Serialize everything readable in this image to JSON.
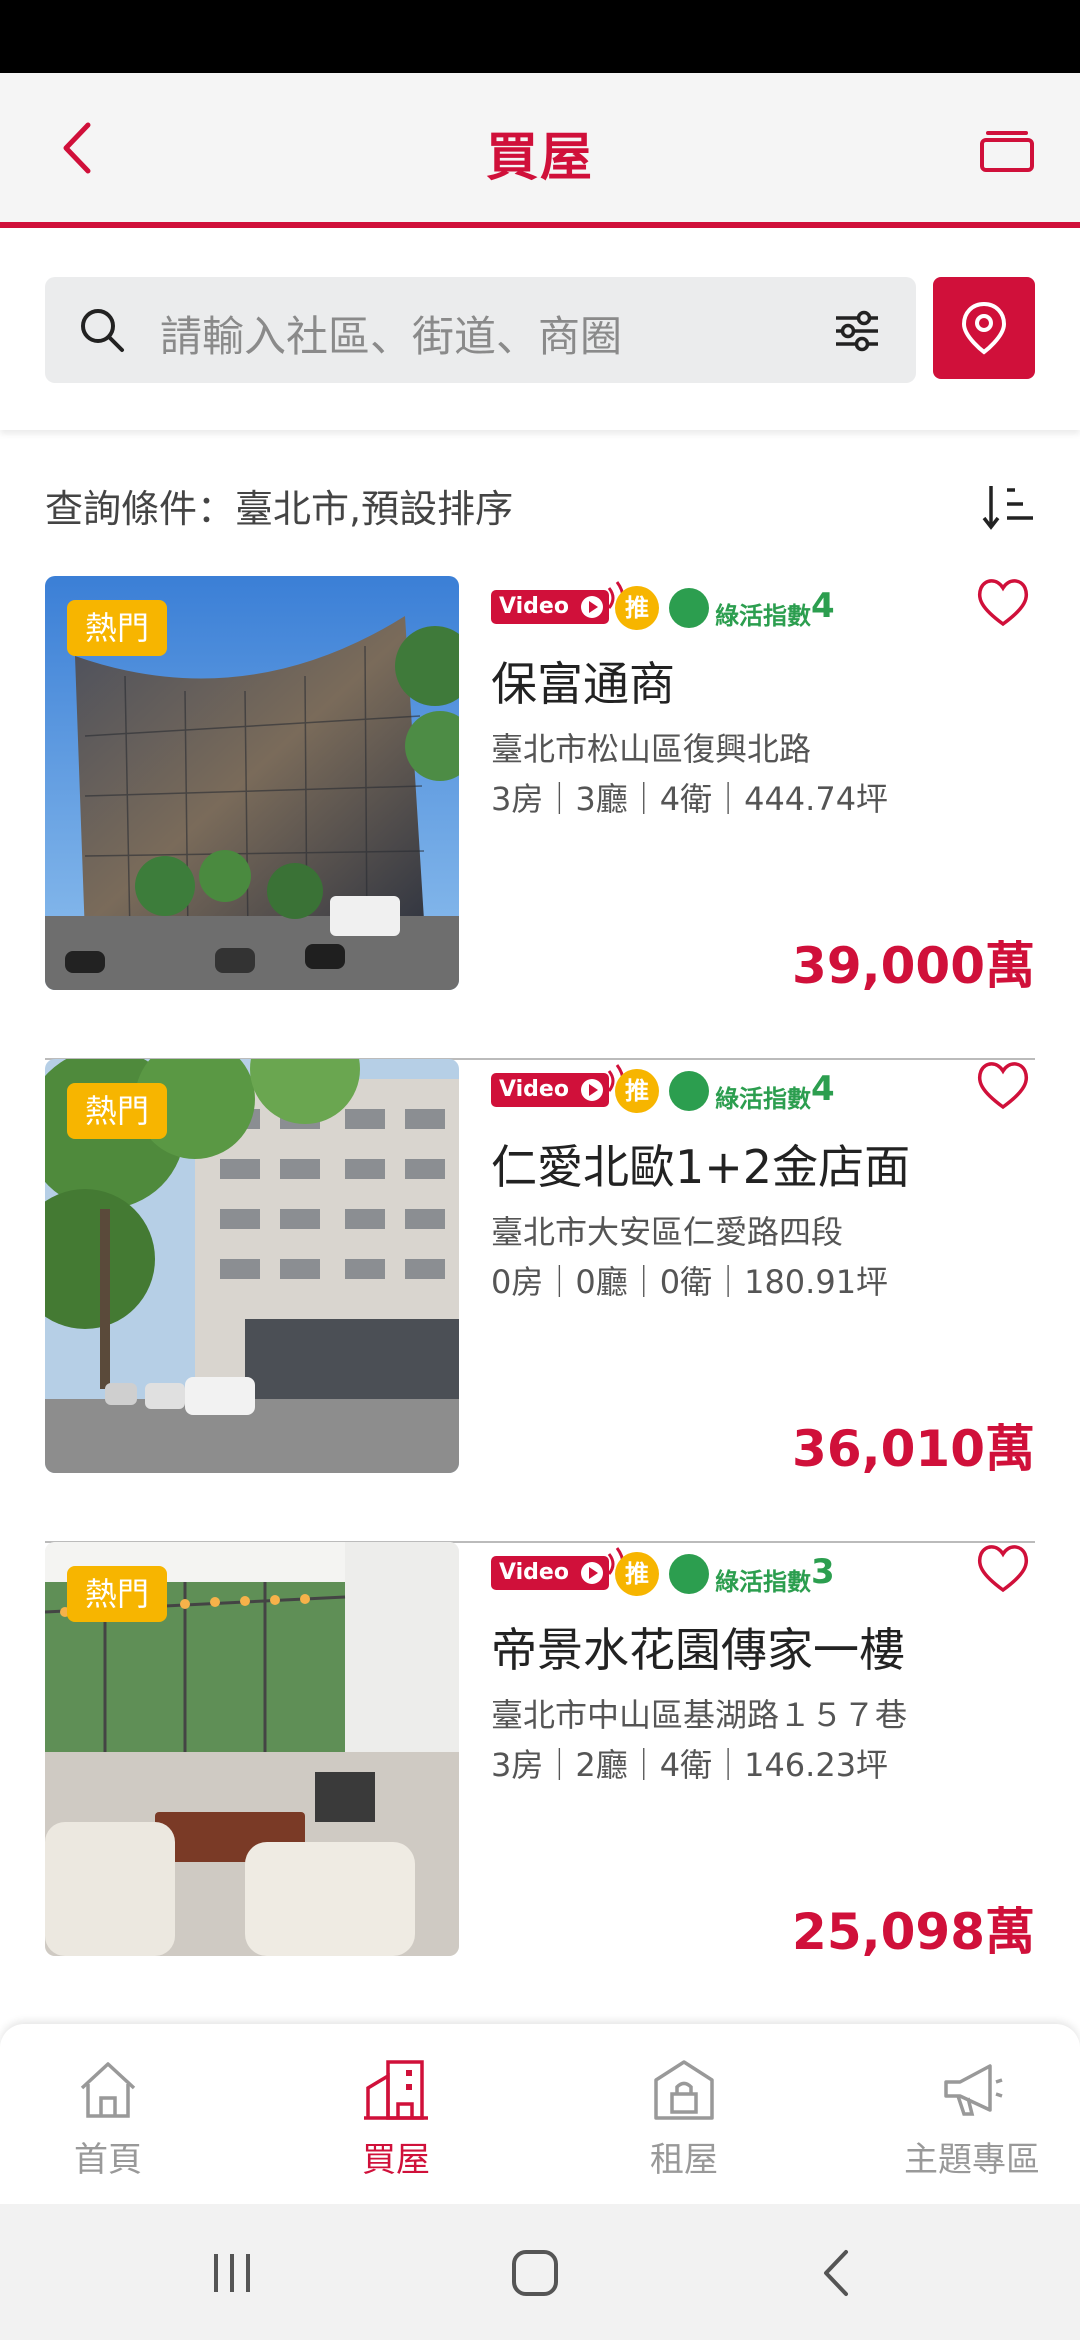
{
  "header": {
    "title": "買屋"
  },
  "search": {
    "placeholder": "請輸入社區、街道、商圈"
  },
  "query": {
    "text": "查詢條件：臺北市,預設排序"
  },
  "listings": [
    {
      "badge": "熱門",
      "video_label": "Video",
      "push_label": "推",
      "green_label": "綠活指數",
      "green_score": "4",
      "name": "保富通商",
      "address": "臺北市松山區復興北路",
      "specs": "3房｜3廳｜4衛｜444.74坪",
      "price": "39,000萬"
    },
    {
      "badge": "熱門",
      "video_label": "Video",
      "push_label": "推",
      "green_label": "綠活指數",
      "green_score": "4",
      "name": "仁愛北歐1+2金店面",
      "address": "臺北市大安區仁愛路四段",
      "specs": "0房｜0廳｜0衛｜180.91坪",
      "price": "36,010萬"
    },
    {
      "badge": "熱門",
      "video_label": "Video",
      "push_label": "推",
      "green_label": "綠活指數",
      "green_score": "3",
      "name": "帝景水花園傳家一樓",
      "address": "臺北市中山區基湖路１５７巷",
      "specs": "3房｜2廳｜4衛｜146.23坪",
      "price": "25,098萬"
    }
  ],
  "bottom_nav": {
    "items": [
      {
        "label": "首頁",
        "icon": "home-icon"
      },
      {
        "label": "買屋",
        "icon": "building-icon",
        "active": true
      },
      {
        "label": "租屋",
        "icon": "house-lock-icon"
      },
      {
        "label": "主題專區",
        "icon": "megaphone-icon"
      }
    ]
  },
  "colors": {
    "brand_red": "#d0103a",
    "hot_yellow": "#f7b500",
    "green": "#2c9e4f"
  }
}
